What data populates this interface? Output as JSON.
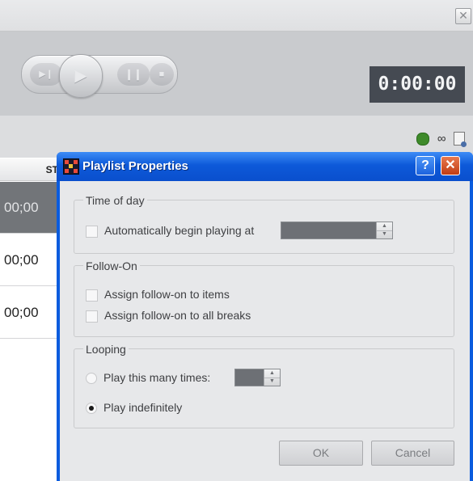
{
  "app": {
    "close_glyph": "✕",
    "transport": {
      "step_play_icon": "step-play-icon",
      "play_icon": "play-icon",
      "pause_icon": "pause-icon",
      "stop_icon": "stop-icon"
    },
    "timer": "0:00:00",
    "toolbar_icons": [
      "recycle-icon",
      "loop-icon",
      "page-user-icon"
    ],
    "grid": {
      "column_header": "ST",
      "rows": [
        "00;00",
        "00;00",
        "00;00"
      ]
    }
  },
  "dialog": {
    "title": "Playlist Properties",
    "help_glyph": "?",
    "close_glyph": "✕",
    "time_of_day": {
      "label": "Time of day",
      "auto_begin_label": "Automatically begin playing at",
      "auto_begin_checked": false,
      "time_value": ""
    },
    "follow_on": {
      "label": "Follow-On",
      "items_label": "Assign follow-on to items",
      "items_checked": false,
      "breaks_label": "Assign follow-on to all breaks",
      "breaks_checked": false
    },
    "looping": {
      "label": "Looping",
      "times_label": "Play this many times:",
      "times_selected": false,
      "times_value": "",
      "indefinite_label": "Play indefinitely",
      "indefinite_selected": true
    },
    "ok_label": "OK",
    "cancel_label": "Cancel"
  },
  "colors": {
    "titlebar": "#0a5cde",
    "dialog_bg": "#e7e8ea",
    "timer_bg": "#454a52",
    "selected_row": "#727579",
    "close_button": "#d8532a"
  }
}
